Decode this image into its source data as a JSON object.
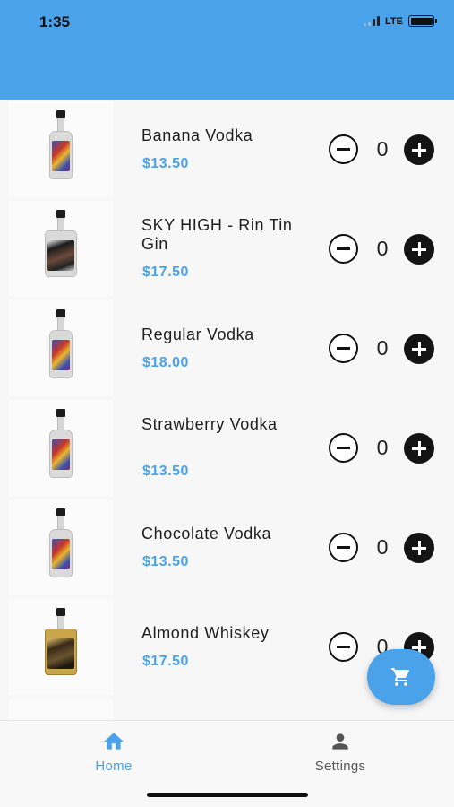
{
  "status_bar": {
    "time": "1:35",
    "network": "LTE"
  },
  "products": [
    {
      "name": "Banana Vodka",
      "price": "$13.50",
      "quantity": "0"
    },
    {
      "name": "SKY HIGH - Rin Tin Gin",
      "price": "$17.50",
      "quantity": "0"
    },
    {
      "name": "Regular Vodka",
      "price": "$18.00",
      "quantity": "0"
    },
    {
      "name": "Strawberry Vodka",
      "price": "$13.50",
      "quantity": "0"
    },
    {
      "name": "Chocolate Vodka",
      "price": "$13.50",
      "quantity": "0"
    },
    {
      "name": "Almond Whiskey",
      "price": "$17.50",
      "quantity": "0"
    }
  ],
  "cart_button": {
    "icon": "cart-icon"
  },
  "tabs": [
    {
      "label": "Home",
      "icon": "home-icon",
      "active": true
    },
    {
      "label": "Settings",
      "icon": "person-icon",
      "active": false
    }
  ],
  "colors": {
    "accent": "#4aa3ea",
    "button_dark": "#141414"
  }
}
